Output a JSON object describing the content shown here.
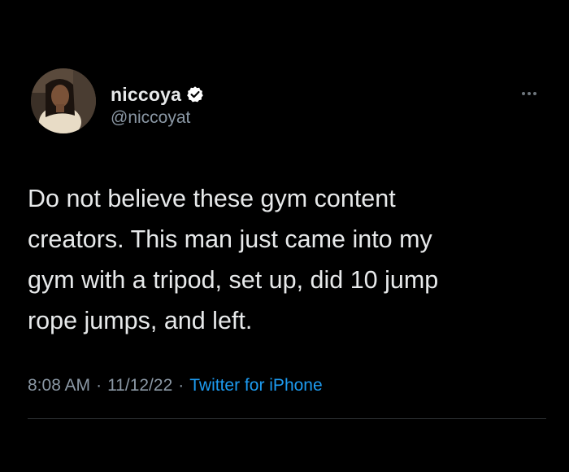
{
  "tweet": {
    "author": {
      "display_name": "niccoya",
      "handle": "@niccoyat",
      "verified": true
    },
    "text": "Do not believe these gym content\ncreators. This man just came into my\ngym with a tripod, set up, did 10 jump\nrope jumps, and left.",
    "time": "8:08 AM",
    "date": "11/12/22",
    "separator": "·",
    "source": "Twitter for iPhone"
  },
  "icons": {
    "verified_badge": "verified-badge-icon",
    "more": "more-options-icon"
  },
  "colors": {
    "background": "#000000",
    "primary_text": "#e7e9ea",
    "secondary_text": "#8b98a5",
    "link": "#1d9bf0"
  }
}
